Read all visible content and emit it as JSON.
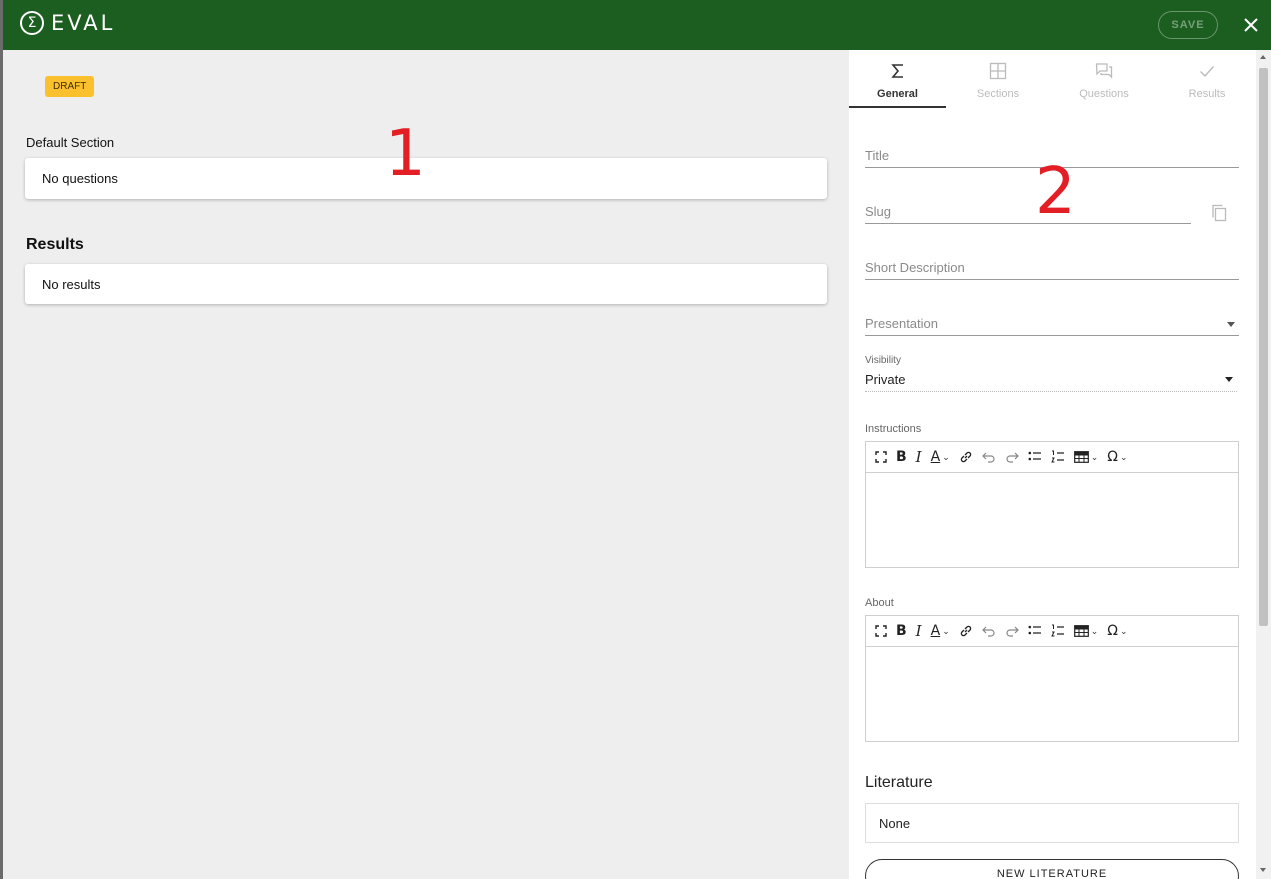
{
  "appbar": {
    "logo_symbol": "Σ",
    "logo_text": "EVAL",
    "save_label": "SAVE",
    "close_icon": "close-icon",
    "color": "#1b5e20"
  },
  "left": {
    "status_badge": "DRAFT",
    "section_title": "Default Section",
    "questions_empty": "No questions",
    "results_heading": "Results",
    "results_empty": "No results",
    "markers": [
      "1",
      "2"
    ]
  },
  "tabs": [
    {
      "label": "General",
      "icon": "sigma-icon",
      "active": true
    },
    {
      "label": "Sections",
      "icon": "grid-icon",
      "active": false
    },
    {
      "label": "Questions",
      "icon": "chat-icon",
      "active": false
    },
    {
      "label": "Results",
      "icon": "check-icon",
      "active": false
    }
  ],
  "form": {
    "title_placeholder": "Title",
    "slug_placeholder": "Slug",
    "short_description_placeholder": "Short Description",
    "presentation_placeholder": "Presentation",
    "visibility_label": "Visibility",
    "visibility_value": "Private",
    "instructions_label": "Instructions",
    "about_label": "About",
    "literature_heading": "Literature",
    "literature_value": "None",
    "new_literature_button": "NEW LITERATURE"
  },
  "editor_toolbar": [
    "fullscreen-icon",
    "bold-icon",
    "italic-icon",
    "font-color-icon",
    "link-icon",
    "undo-icon",
    "redo-icon",
    "bullet-list-icon",
    "numbered-list-icon",
    "table-icon",
    "special-char-icon"
  ]
}
